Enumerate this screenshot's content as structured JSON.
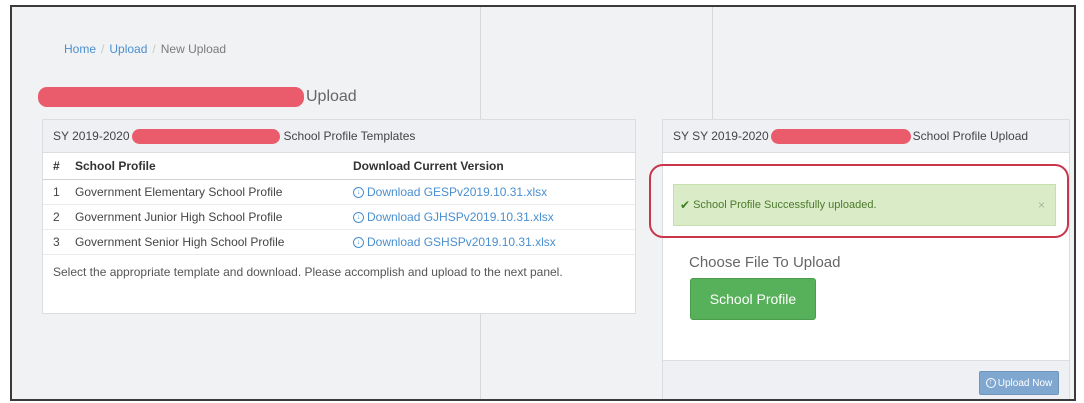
{
  "breadcrumb": {
    "home": "Home",
    "upload": "Upload",
    "current": "New Upload",
    "separator": "/"
  },
  "page": {
    "title_suffix": "Upload"
  },
  "left_panel": {
    "title_prefix": "SY 2019-2020",
    "title_suffix": "School Profile Templates",
    "columns": [
      "#",
      "School Profile",
      "Download Current Version"
    ],
    "rows": [
      {
        "num": "1",
        "profile": "Government Elementary School Profile",
        "download": "Download GESPv2019.10.31.xlsx"
      },
      {
        "num": "2",
        "profile": "Government Junior High School Profile",
        "download": "Download GJHSPv2019.10.31.xlsx"
      },
      {
        "num": "3",
        "profile": "Government Senior High School Profile",
        "download": "Download GSHSPv2019.10.31.xlsx"
      }
    ],
    "note": "Select the appropriate template and download. Please accomplish and upload to the next panel."
  },
  "right_panel": {
    "title_prefix": "SY SY 2019-2020",
    "title_suffix": "School Profile Upload",
    "alert_message": "School Profile Successfully uploaded.",
    "alert_close": "×",
    "choose_label": "Choose File To Upload",
    "file_button": "School Profile",
    "upload_button": "Upload Now"
  },
  "icons": {
    "download": "download-circle-icon",
    "check": "check-icon",
    "upload": "upload-circle-icon"
  },
  "colors": {
    "link": "#4a8fd0",
    "redaction": "#ea5c6b",
    "success_bg": "#d9ebc7",
    "file_button": "#57b05a",
    "upload_button": "#7fa7cf",
    "highlight_ring": "#c9354a"
  }
}
